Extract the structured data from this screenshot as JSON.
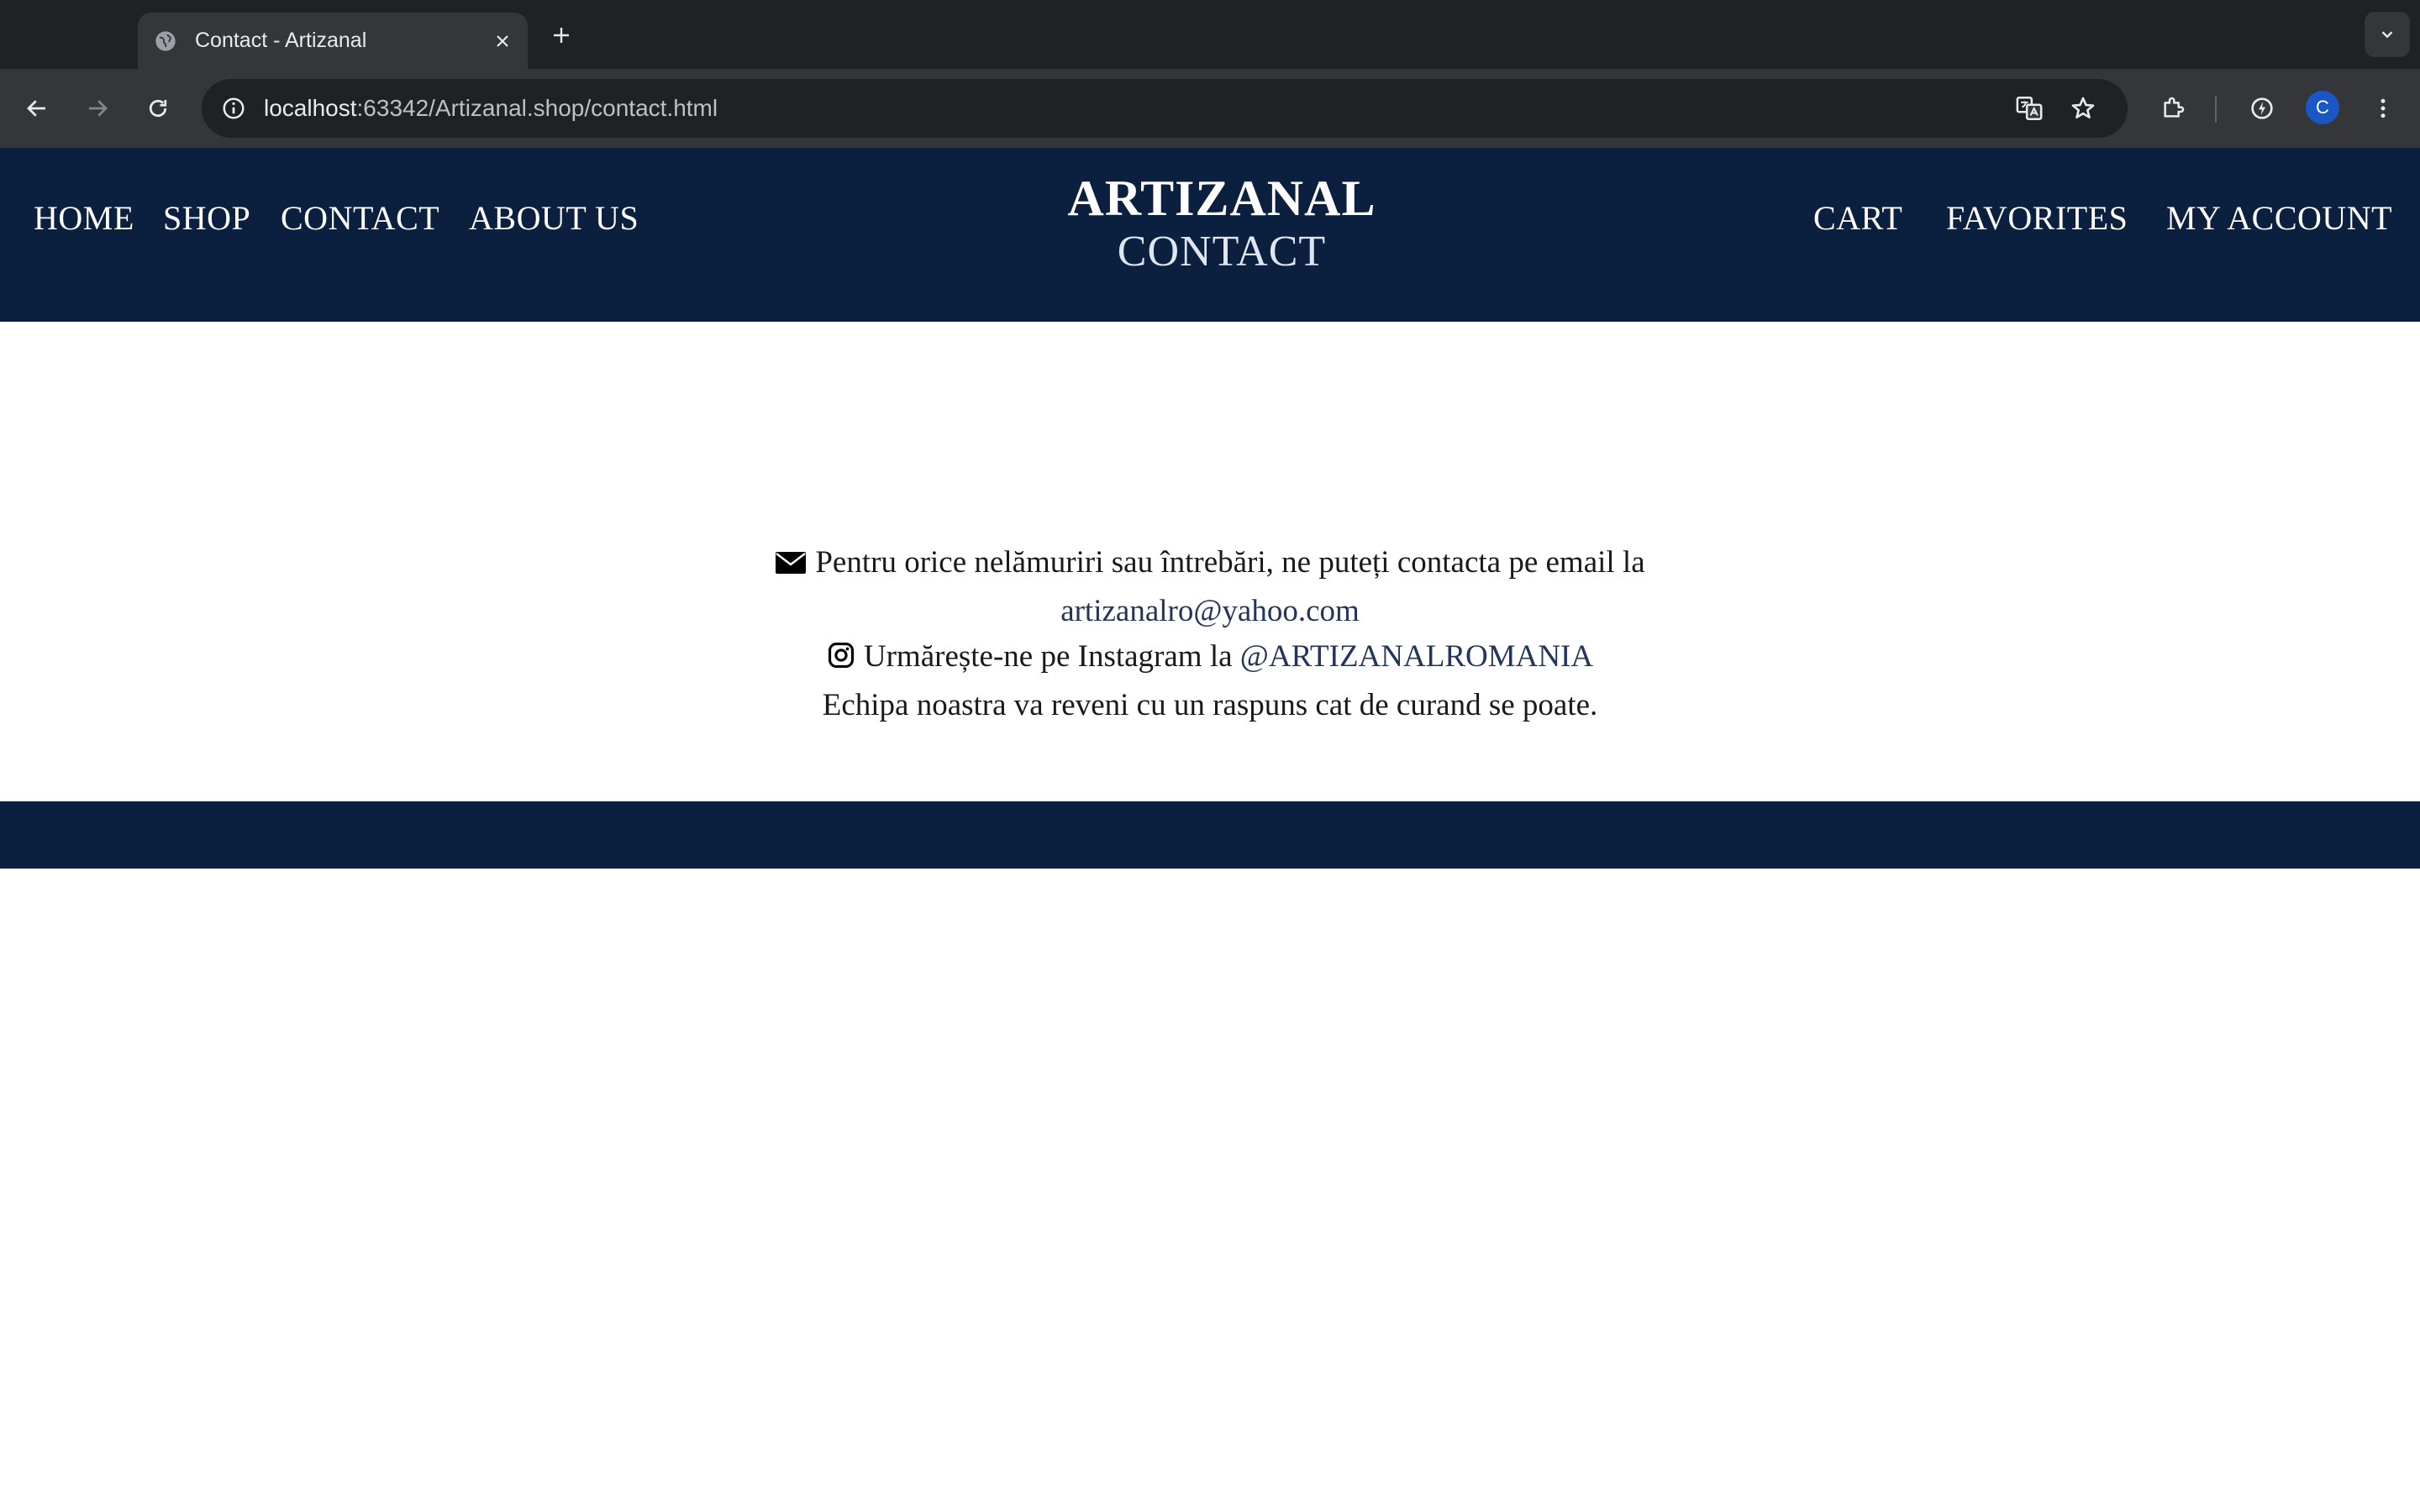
{
  "browser": {
    "tab": {
      "title": "Contact - Artizanal"
    },
    "address_bar": {
      "host": "localhost",
      "path": ":63342/Artizanal.shop/contact.html"
    },
    "profile_initial": "C"
  },
  "header": {
    "nav_left": [
      {
        "label": "HOME"
      },
      {
        "label": "SHOP"
      },
      {
        "label": "CONTACT"
      },
      {
        "label": "ABOUT US"
      }
    ],
    "brand": "ARTIZANAL",
    "page_title": "CONTACT",
    "nav_right": [
      {
        "label": "CART"
      },
      {
        "label": "FAVORITES"
      },
      {
        "label": "MY ACCOUNT"
      }
    ]
  },
  "contact": {
    "email_text": "Pentru orice nelămuriri sau întrebări, ne puteți contacta pe email la",
    "email_address": "artizanalro@yahoo.com",
    "instagram_text": "Urmărește-ne pe Instagram la",
    "instagram_handle": "@ARTIZANALROMANIA",
    "reply_note": "Echipa noastra va reveni cu un raspuns cat de curand se poate."
  },
  "colors": {
    "header_bg": "#0b1f3f",
    "link": "#23355a",
    "chrome_dark": "#202124",
    "chrome_toolbar": "#35363a"
  }
}
